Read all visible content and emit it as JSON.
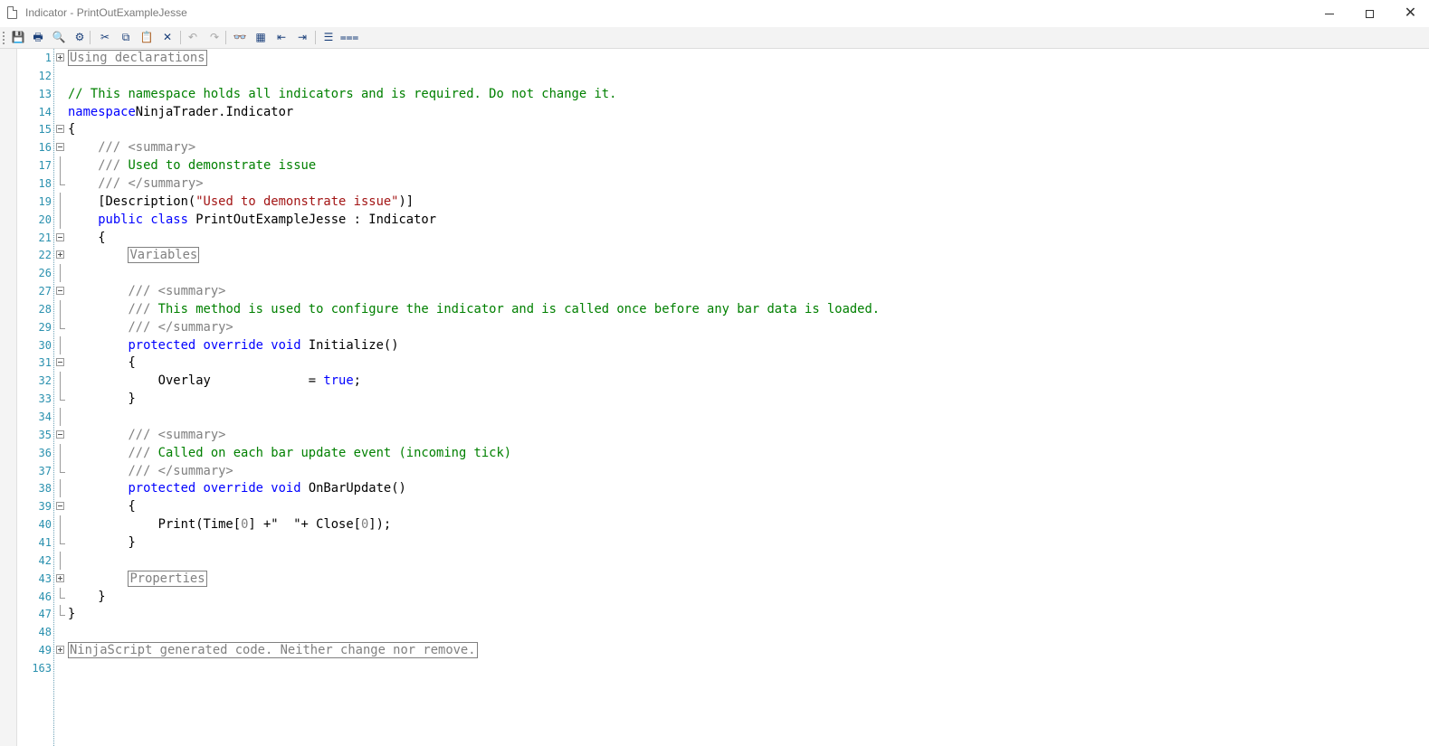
{
  "window": {
    "title": "Indicator - PrintOutExampleJesse",
    "minimize_icon": "minimize-icon",
    "maximize_icon": "maximize-icon",
    "close_icon": "close-icon"
  },
  "toolbar": {
    "buttons": [
      {
        "name": "save-button",
        "icon": "save-icon",
        "glyph": "💾",
        "enabled": true
      },
      {
        "name": "print-button",
        "icon": "print-icon",
        "glyph": "🖶",
        "enabled": true
      },
      {
        "name": "print-preview-button",
        "icon": "print-preview-icon",
        "glyph": "🔍",
        "enabled": true
      },
      {
        "name": "compile-button",
        "icon": "compile-icon",
        "glyph": "⚙",
        "enabled": true
      },
      {
        "name": "cut-button",
        "icon": "cut-icon",
        "glyph": "✂",
        "enabled": true
      },
      {
        "name": "copy-button",
        "icon": "copy-icon",
        "glyph": "⧉",
        "enabled": true
      },
      {
        "name": "paste-button",
        "icon": "paste-icon",
        "glyph": "📋",
        "enabled": true
      },
      {
        "name": "delete-button",
        "icon": "delete-icon",
        "glyph": "✕",
        "enabled": true
      },
      {
        "name": "undo-button",
        "icon": "undo-icon",
        "glyph": "↶",
        "enabled": false
      },
      {
        "name": "redo-button",
        "icon": "redo-icon",
        "glyph": "↷",
        "enabled": false
      },
      {
        "name": "find-button",
        "icon": "binoculars-icon",
        "glyph": "👓",
        "enabled": true
      },
      {
        "name": "find-replace-button",
        "icon": "find-replace-icon",
        "glyph": "▦",
        "enabled": true
      },
      {
        "name": "outdent-button",
        "icon": "outdent-icon",
        "glyph": "⇤",
        "enabled": true
      },
      {
        "name": "indent-button",
        "icon": "indent-icon",
        "glyph": "⇥",
        "enabled": true
      },
      {
        "name": "comment-button",
        "icon": "comment-lines-icon",
        "glyph": "☰",
        "enabled": true
      },
      {
        "name": "uncomment-button",
        "icon": "uncomment-lines-icon",
        "glyph": "⩶",
        "enabled": true
      }
    ]
  },
  "colors": {
    "keyword": "#0000ff",
    "comment": "#008000",
    "xmldoc_tag": "#808080",
    "string": "#a31515",
    "line_number": "#2b91af"
  },
  "code_lines": [
    {
      "n": "1",
      "fold": "plus",
      "tokens": [
        [
          "region",
          "Using declarations"
        ]
      ]
    },
    {
      "n": "12",
      "fold": "",
      "tokens": []
    },
    {
      "n": "13",
      "fold": "",
      "tokens": [
        [
          "cm",
          "// This namespace holds all indicators and is required. Do not change it."
        ]
      ]
    },
    {
      "n": "14",
      "fold": "",
      "tokens": [
        [
          "kw",
          "namespace"
        ],
        [
          "",
          "NinjaTrader.Indicator"
        ]
      ]
    },
    {
      "n": "15",
      "fold": "minus",
      "tokens": [
        [
          "",
          "{"
        ]
      ]
    },
    {
      "n": "16",
      "fold": "minus",
      "tokens": [
        [
          "",
          "    "
        ],
        [
          "xd",
          "/// <summary>"
        ]
      ]
    },
    {
      "n": "17",
      "fold": "bar",
      "tokens": [
        [
          "",
          "    "
        ],
        [
          "xd",
          "///"
        ],
        [
          "cm",
          " Used to demonstrate issue"
        ]
      ]
    },
    {
      "n": "18",
      "fold": "end",
      "tokens": [
        [
          "",
          "    "
        ],
        [
          "xd",
          "/// </summary>"
        ]
      ]
    },
    {
      "n": "19",
      "fold": "bar",
      "tokens": [
        [
          "",
          "    [Description("
        ],
        [
          "st",
          "\"Used to demonstrate issue\""
        ],
        [
          "",
          ")]"
        ]
      ]
    },
    {
      "n": "20",
      "fold": "bar",
      "tokens": [
        [
          "",
          "    "
        ],
        [
          "kw",
          "public class"
        ],
        [
          "",
          " PrintOutExampleJesse : Indicator"
        ]
      ]
    },
    {
      "n": "21",
      "fold": "minus",
      "tokens": [
        [
          "",
          "    {"
        ]
      ]
    },
    {
      "n": "22",
      "fold": "plus",
      "tokens": [
        [
          "",
          "        "
        ],
        [
          "region",
          "Variables"
        ]
      ]
    },
    {
      "n": "26",
      "fold": "bar",
      "tokens": []
    },
    {
      "n": "27",
      "fold": "minus",
      "tokens": [
        [
          "",
          "        "
        ],
        [
          "xd",
          "/// <summary>"
        ]
      ]
    },
    {
      "n": "28",
      "fold": "bar",
      "tokens": [
        [
          "",
          "        "
        ],
        [
          "xd",
          "///"
        ],
        [
          "cm",
          " This method is used to configure the indicator and is called once before any bar data is loaded."
        ]
      ]
    },
    {
      "n": "29",
      "fold": "end",
      "tokens": [
        [
          "",
          "        "
        ],
        [
          "xd",
          "/// </summary>"
        ]
      ]
    },
    {
      "n": "30",
      "fold": "bar",
      "tokens": [
        [
          "",
          "        "
        ],
        [
          "kw",
          "protected override void"
        ],
        [
          "",
          " Initialize()"
        ]
      ]
    },
    {
      "n": "31",
      "fold": "minus",
      "tokens": [
        [
          "",
          "        {"
        ]
      ]
    },
    {
      "n": "32",
      "fold": "bar",
      "tokens": [
        [
          "",
          "            Overlay             = "
        ],
        [
          "kw",
          "true"
        ],
        [
          "",
          ";"
        ]
      ]
    },
    {
      "n": "33",
      "fold": "end",
      "tokens": [
        [
          "",
          "        }"
        ]
      ]
    },
    {
      "n": "34",
      "fold": "bar",
      "tokens": []
    },
    {
      "n": "35",
      "fold": "minus",
      "tokens": [
        [
          "",
          "        "
        ],
        [
          "xd",
          "/// <summary>"
        ]
      ]
    },
    {
      "n": "36",
      "fold": "bar",
      "tokens": [
        [
          "",
          "        "
        ],
        [
          "xd",
          "///"
        ],
        [
          "cm",
          " Called on each bar update event (incoming tick)"
        ]
      ]
    },
    {
      "n": "37",
      "fold": "end",
      "tokens": [
        [
          "",
          "        "
        ],
        [
          "xd",
          "/// </summary>"
        ]
      ]
    },
    {
      "n": "38",
      "fold": "bar",
      "tokens": [
        [
          "",
          "        "
        ],
        [
          "kw",
          "protected override void"
        ],
        [
          "",
          " OnBarUpdate()"
        ]
      ]
    },
    {
      "n": "39",
      "fold": "minus",
      "tokens": [
        [
          "",
          "        {"
        ]
      ]
    },
    {
      "n": "40",
      "fold": "bar",
      "tokens": [
        [
          "",
          "            Print(Time["
        ],
        [
          "num",
          "0"
        ],
        [
          "",
          "] +\"  \"+ Close["
        ],
        [
          "num",
          "0"
        ],
        [
          "",
          "]);"
        ]
      ]
    },
    {
      "n": "41",
      "fold": "end",
      "tokens": [
        [
          "",
          "        }"
        ]
      ]
    },
    {
      "n": "42",
      "fold": "bar",
      "tokens": []
    },
    {
      "n": "43",
      "fold": "plus",
      "tokens": [
        [
          "",
          "        "
        ],
        [
          "region",
          "Properties"
        ]
      ]
    },
    {
      "n": "46",
      "fold": "end",
      "tokens": [
        [
          "",
          "    }"
        ]
      ]
    },
    {
      "n": "47",
      "fold": "end",
      "tokens": [
        [
          "",
          "}"
        ]
      ]
    },
    {
      "n": "48",
      "fold": "",
      "tokens": []
    },
    {
      "n": "49",
      "fold": "plus",
      "tokens": [
        [
          "region",
          "NinjaScript generated code. Neither change nor remove."
        ]
      ]
    },
    {
      "n": "163",
      "fold": "",
      "tokens": []
    }
  ]
}
